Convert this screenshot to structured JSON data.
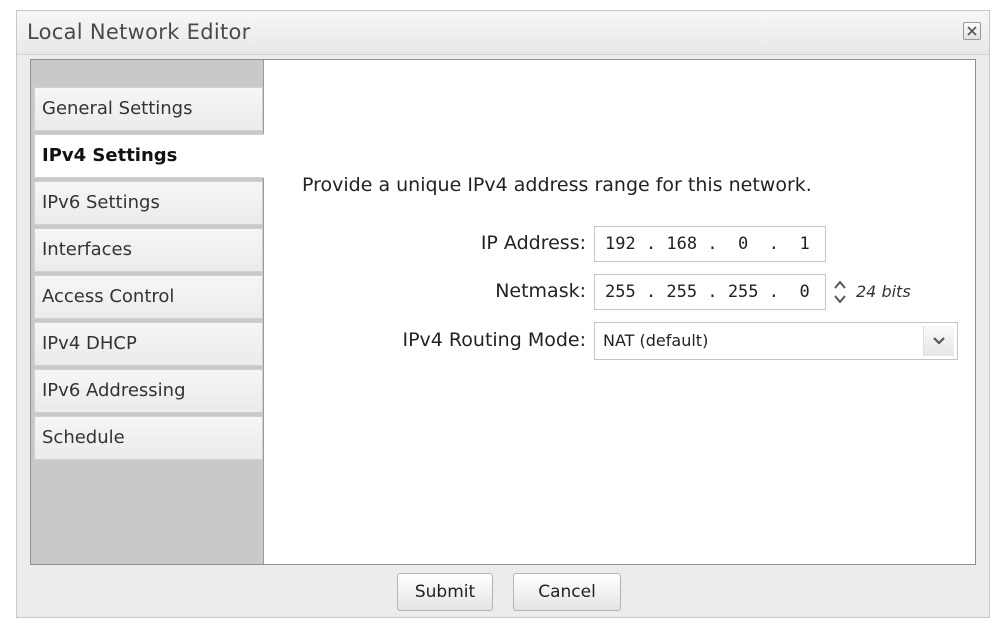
{
  "dialog": {
    "title": "Local Network Editor",
    "close_icon": "close-icon"
  },
  "sidebar": {
    "items": [
      {
        "label": "General Settings",
        "active": false
      },
      {
        "label": "IPv4 Settings",
        "active": true
      },
      {
        "label": "IPv6 Settings",
        "active": false
      },
      {
        "label": "Interfaces",
        "active": false
      },
      {
        "label": "Access Control",
        "active": false
      },
      {
        "label": "IPv4 DHCP",
        "active": false
      },
      {
        "label": "IPv6 Addressing",
        "active": false
      },
      {
        "label": "Schedule",
        "active": false
      }
    ]
  },
  "main": {
    "instruction": "Provide a unique IPv4 address range for this network.",
    "ip_address": {
      "label": "IP Address:",
      "value": "192 . 168 .  0  .  1"
    },
    "netmask": {
      "label": "Netmask:",
      "value": "255 . 255 . 255 .  0",
      "bits": "24 bits"
    },
    "routing_mode": {
      "label": "IPv4 Routing Mode:",
      "value": "NAT (default)"
    }
  },
  "footer": {
    "submit_label": "Submit",
    "cancel_label": "Cancel"
  },
  "colors": {
    "sidebar_bg": "#c9c9c9",
    "dialog_bg": "#ececec",
    "border": "#8f8f8f"
  }
}
